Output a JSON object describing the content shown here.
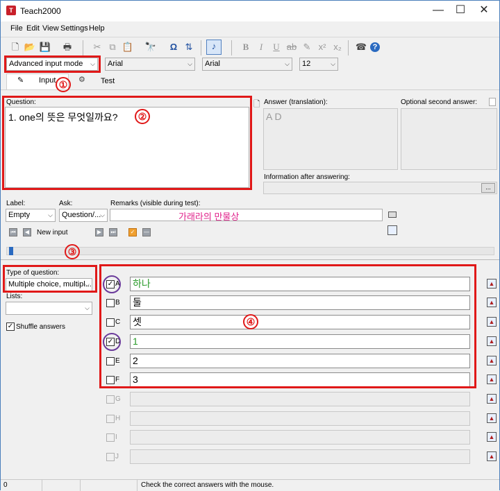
{
  "window": {
    "title": "Teach2000",
    "app_icon_text": "T"
  },
  "titlebar_controls": {
    "minimize": "—",
    "maximize": "☐",
    "close": "✕"
  },
  "menu": [
    "File",
    "Edit",
    "View",
    "Settings",
    "Help"
  ],
  "toolbar": {
    "mode_select": "Advanced input mode",
    "font1": "Arial",
    "font2": "Arial",
    "font_size": "12",
    "icons": [
      "new-icon",
      "open-icon",
      "save-icon",
      "print-icon",
      "cut-icon",
      "copy-icon",
      "paste-icon",
      "find-icon",
      "omega-icon",
      "sort-icon",
      "music-note-icon",
      "bold-icon",
      "italic-icon",
      "underline-icon",
      "strikethrough-icon",
      "pen-icon",
      "superscript-icon",
      "subscript-icon",
      "phone-icon",
      "help-icon"
    ]
  },
  "tabs": {
    "input": "Input",
    "test": "Test"
  },
  "question": {
    "label": "Question:",
    "text": "1. one의 뜻은 무엇일까요?"
  },
  "answer": {
    "label": "Answer (translation):",
    "text": "A D"
  },
  "second_answer": {
    "label": "Optional second answer:"
  },
  "info_after": {
    "label": "Information after answering:",
    "btn": "..."
  },
  "label_field": {
    "label": "Label:",
    "value": "Empty"
  },
  "ask_field": {
    "label": "Ask:",
    "value": "Question/..."
  },
  "remarks": {
    "label": "Remarks (visible during test):",
    "value": "가래라의 만물상"
  },
  "nav": {
    "new_input": "New input"
  },
  "type_of_question": {
    "label": "Type of question:",
    "value": "Multiple choice, multipl..."
  },
  "lists": {
    "label": "Lists:",
    "value": ""
  },
  "shuffle": {
    "label": "Shuffle answers",
    "checked": true
  },
  "choices": [
    {
      "letter": "A",
      "text": "하나",
      "checked": true,
      "enabled": true,
      "green": true
    },
    {
      "letter": "B",
      "text": "둘",
      "checked": false,
      "enabled": true,
      "green": false
    },
    {
      "letter": "C",
      "text": "셋",
      "checked": false,
      "enabled": true,
      "green": false
    },
    {
      "letter": "D",
      "text": "1",
      "checked": true,
      "enabled": true,
      "green": true
    },
    {
      "letter": "E",
      "text": "2",
      "checked": false,
      "enabled": true,
      "green": false
    },
    {
      "letter": "F",
      "text": "3",
      "checked": false,
      "enabled": true,
      "green": false
    },
    {
      "letter": "G",
      "text": "",
      "checked": false,
      "enabled": false,
      "green": false
    },
    {
      "letter": "H",
      "text": "",
      "checked": false,
      "enabled": false,
      "green": false
    },
    {
      "letter": "I",
      "text": "",
      "checked": false,
      "enabled": false,
      "green": false
    },
    {
      "letter": "J",
      "text": "",
      "checked": false,
      "enabled": false,
      "green": false
    }
  ],
  "annotations": [
    "①",
    "②",
    "③",
    "④"
  ],
  "status": {
    "count": "0",
    "message": "Check the correct answers with the mouse."
  },
  "colors": {
    "red_frame": "#e01818",
    "purple_circle": "#6a3a9a",
    "green_text": "#2a9a2a",
    "pink_text": "#e0208a"
  }
}
